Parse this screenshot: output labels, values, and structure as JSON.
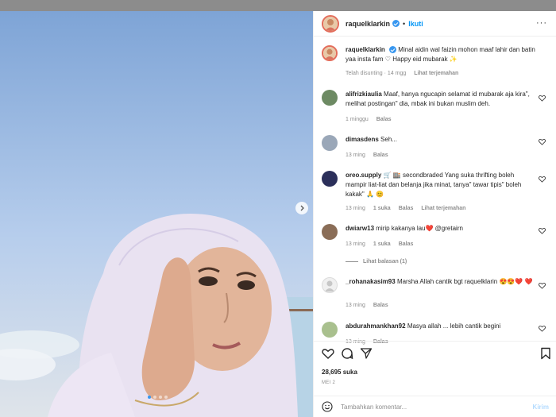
{
  "post": {
    "username": "raquelklarkin",
    "follow_label": "Ikuti",
    "dot": "•",
    "caption_user": "raquelklarkin",
    "caption_text": "Minal aidin wal faizin mohon maaf lahir dan batin yaa insta fam ♡ Happy eid mubarak ✨",
    "caption_meta_edited": "Telah disunting · 14 mgg",
    "caption_meta_translate": "Lihat terjemahan",
    "likes": "28,695 suka",
    "date": "MEI 2",
    "composer_placeholder": "Tambahkan komentar...",
    "send_label": "Kirim",
    "more_label": "···"
  },
  "comments": [
    {
      "user": "alifrizkiaulia",
      "text": "Maaf, hanya ngucapin selamat id mubarak aja kira\", melihat postingan\" dia, mbak ini bukan muslim deh.",
      "time": "1 minggu",
      "likes": "",
      "reply": "Balas",
      "translate": ""
    },
    {
      "user": "dimasdens",
      "text": "Seh...",
      "time": "13 ming",
      "likes": "",
      "reply": "Balas",
      "translate": ""
    },
    {
      "user": "oreo.supply",
      "text": "🛒 🏬 secondbraded Yang suka thrifting boleh mampir liat-liat dan belanja jika minat, tanya\" tawar tipis\" boleh kakak\" 🙏 😊",
      "time": "13 ming",
      "likes": "1 suka",
      "reply": "Balas",
      "translate": "Lihat terjemahan"
    },
    {
      "user": "dwiarw13",
      "text": "mirip kakanya lau❤️ @gretairn",
      "time": "13 ming",
      "likes": "1 suka",
      "reply": "Balas",
      "translate": ""
    },
    {
      "user": "_rohanakasim93",
      "text": "Marsha Allah cantik bgt raquelklarin 😍😍❤️ ❤️",
      "time": "13 ming",
      "likes": "",
      "reply": "Balas",
      "translate": ""
    },
    {
      "user": "abdurahmankhan92",
      "text": "Masya allah ... lebih cantik begini",
      "time": "13 ming",
      "likes": "",
      "reply": "Balas",
      "translate": ""
    }
  ],
  "view_replies": "Lihat balasan (1)",
  "icons": {
    "like": "heart-icon",
    "comment": "comment-icon",
    "share": "share-icon",
    "save": "bookmark-icon",
    "emoji": "emoji-icon",
    "next": "chevron-right-icon"
  },
  "colors": {
    "accent": "#0095f6",
    "heart_red": "#ed4956"
  }
}
